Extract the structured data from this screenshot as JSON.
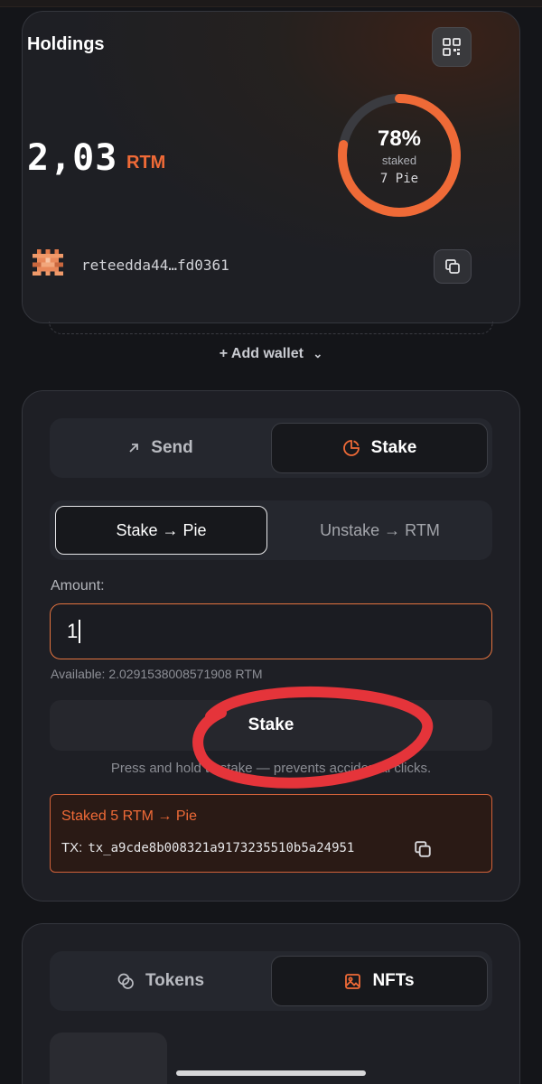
{
  "holdings": {
    "title": "Holdings",
    "balance": "2,03",
    "unit": "RTM",
    "staked_percent_label": "78%",
    "staked_fraction": 0.78,
    "staked_label": "staked",
    "pie_label": "7 Pie",
    "address": "reteedda44…fd0361",
    "add_wallet": "+ Add wallet"
  },
  "action_tabs": [
    {
      "label": "Send",
      "icon": "arrow-up-right-icon",
      "active": false
    },
    {
      "label": "Stake",
      "icon": "pie-chart-icon",
      "active": true
    }
  ],
  "stake_modes": [
    {
      "label": "Stake → Pie",
      "active": true
    },
    {
      "label": "Unstake → RTM",
      "active": false
    }
  ],
  "amount": {
    "label": "Amount:",
    "value": "1",
    "available": "Available: 2.0291538008571908 RTM"
  },
  "stake_button": "Stake",
  "hint": "Press and hold to stake — prevents accidental clicks.",
  "notice": {
    "title": "Staked 5 RTM → Pie",
    "tx_label": "TX:",
    "tx_id": "tx_a9cde8b008321a9173235510b5a24951"
  },
  "asset_tabs": [
    {
      "label": "Tokens",
      "icon": "coins-icon",
      "active": false
    },
    {
      "label": "NFTs",
      "icon": "image-icon",
      "active": true
    }
  ],
  "colors": {
    "accent": "#ef6a37",
    "annotation": "#e5343a",
    "background": "#141519"
  }
}
